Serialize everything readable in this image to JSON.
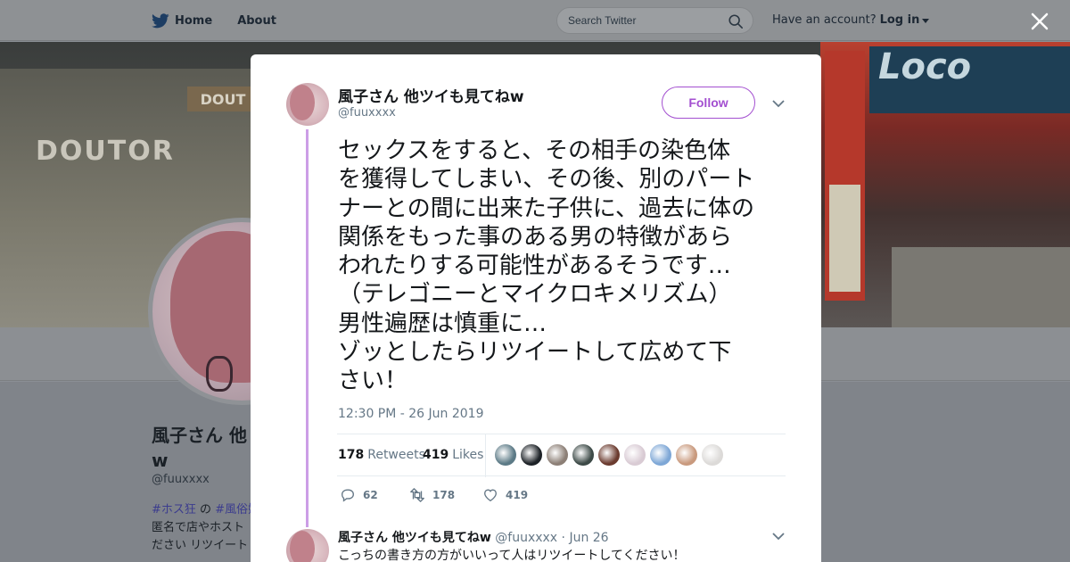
{
  "nav": {
    "home_label": "Home",
    "about_label": "About",
    "search_placeholder": "Search Twitter",
    "account_prompt": "Have an account?",
    "login_label": "Log in"
  },
  "banner": {
    "sign_left_1": "DOUT",
    "sign_left_2": "DOUTOR",
    "sign_right": "Loco"
  },
  "profile": {
    "name_partial": "風子さん 他",
    "name_tail": "w",
    "handle": "@fuuxxxx",
    "bio_tag1": "#ホス狂",
    "bio_of": " の ",
    "bio_tag2": "#風俗嬢",
    "bio_line2": "匿名で店やホスト",
    "bio_line3": "ださい リツイート"
  },
  "tweet": {
    "author_name": "風子さん 他ツイも見てねw",
    "author_handle": "@fuuxxxx",
    "follow_label": "Follow",
    "text": "セックスをすると、その相手の染色体\nを獲得してしまい、その後、別のパート\nナーとの間に出来た子供に、過去に体の\n関係をもった事のある男の特徴があら\nわれたりする可能性があるそうです…\n（テレゴニーとマイクロキメリズム）\n男性遍歴は慎重に…\nゾッとしたらリツイートして広めて下\nさい！",
    "timestamp": "12:30 PM - 26 Jun 2019",
    "retweet_count": "178",
    "retweet_label": "Retweets",
    "like_count": "419",
    "like_label": "Likes",
    "reply_action_count": "62",
    "retweet_action_count": "178",
    "like_action_count": "419",
    "likers": [
      "#5c7a86",
      "#1d2227",
      "#8c7f76",
      "#3d4a47",
      "#6b3b2f",
      "#d9cbd4",
      "#7ea7d6",
      "#c99a7e",
      "#dcdad8"
    ]
  },
  "reply": {
    "author_name": "風子さん 他ツイも見てねw",
    "author_handle": "@fuuxxxx",
    "separator": " · ",
    "date": "Jun 26",
    "text": "こっちの書き方の方がいいって人はリツイートしてください！"
  },
  "colors": {
    "accent": "#a34fd0",
    "thread_line": "#cc9ee6",
    "overlay": "#8a8f95"
  }
}
